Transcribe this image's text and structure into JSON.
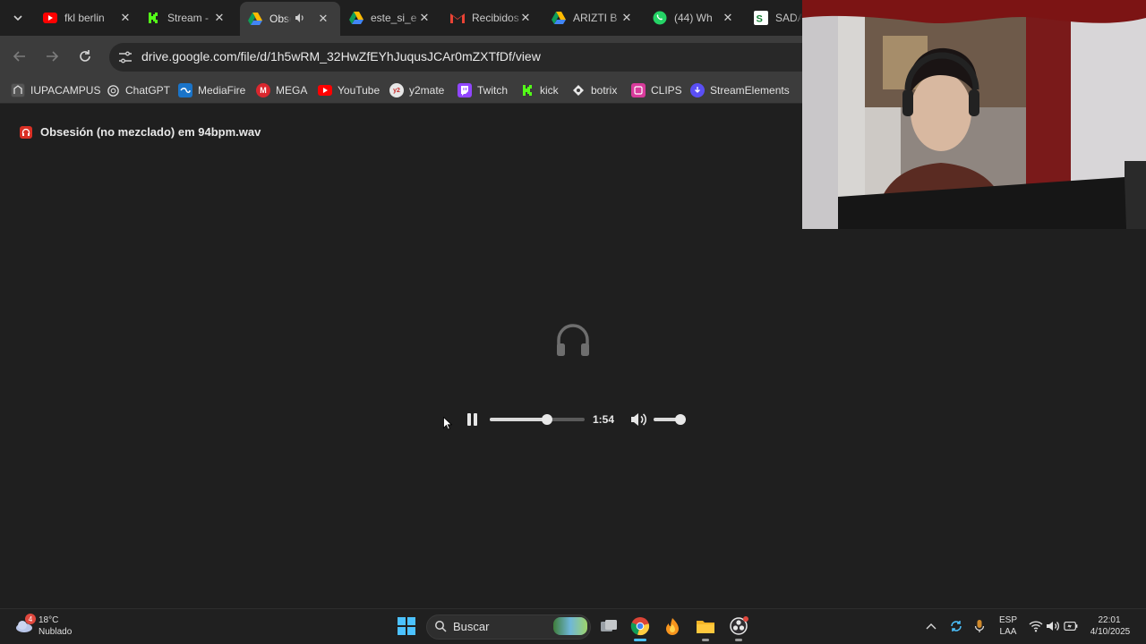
{
  "browser": {
    "tabs": [
      {
        "title": "fkl berlin",
        "favicon": "youtube-icon",
        "active": false
      },
      {
        "title": "Stream -",
        "favicon": "kick-icon",
        "active": false
      },
      {
        "title": "Obsesión",
        "favicon": "google-drive-icon",
        "active": true,
        "audio": true
      },
      {
        "title": "este_si_e",
        "favicon": "google-drive-icon",
        "active": false
      },
      {
        "title": "Recibidos",
        "favicon": "gmail-icon",
        "active": false
      },
      {
        "title": "ARIZTI B",
        "favicon": "google-drive-icon",
        "active": false
      },
      {
        "title": "(44) Wh",
        "favicon": "whatsapp-icon",
        "active": false
      },
      {
        "title": "SADAI",
        "favicon": "sheets-icon",
        "active": false
      }
    ],
    "url": "drive.google.com/file/d/1h5wRM_32HwZfEYhJuqusJCAr0mZXTfDf/view",
    "bookmarks": [
      {
        "label": "IUPACAMPUS",
        "icon": "iupa-icon"
      },
      {
        "label": "ChatGPT",
        "icon": "chatgpt-icon"
      },
      {
        "label": "MediaFire",
        "icon": "mediafire-icon"
      },
      {
        "label": "MEGA",
        "icon": "mega-icon"
      },
      {
        "label": "YouTube",
        "icon": "youtube-icon"
      },
      {
        "label": "y2mate",
        "icon": "y2mate-icon"
      },
      {
        "label": "Twitch",
        "icon": "twitch-icon"
      },
      {
        "label": "kick",
        "icon": "kick-icon"
      },
      {
        "label": "botrix",
        "icon": "botrix-icon"
      },
      {
        "label": "CLIPS",
        "icon": "clips-icon"
      },
      {
        "label": "StreamElements",
        "icon": "streamelements-icon"
      }
    ]
  },
  "file": {
    "name": "Obsesión (no mezclado) em 94bpm.wav"
  },
  "player": {
    "state": "playing",
    "progress": 0.6,
    "time": "1:54",
    "volume": 1.0
  },
  "taskbar": {
    "weather": {
      "temp": "18°C",
      "desc": "Nublado",
      "badge": "4"
    },
    "search_text": "Buscar",
    "tray": {
      "lang_top": "ESP",
      "lang_bottom": "LAA",
      "time": "22:01",
      "date": "4/10/2025"
    }
  },
  "colors": {
    "background": "#1f1f1f",
    "toolbar": "#3c3c3c",
    "accent": "#4cc2ff",
    "drive_audio_red": "#d93025"
  }
}
